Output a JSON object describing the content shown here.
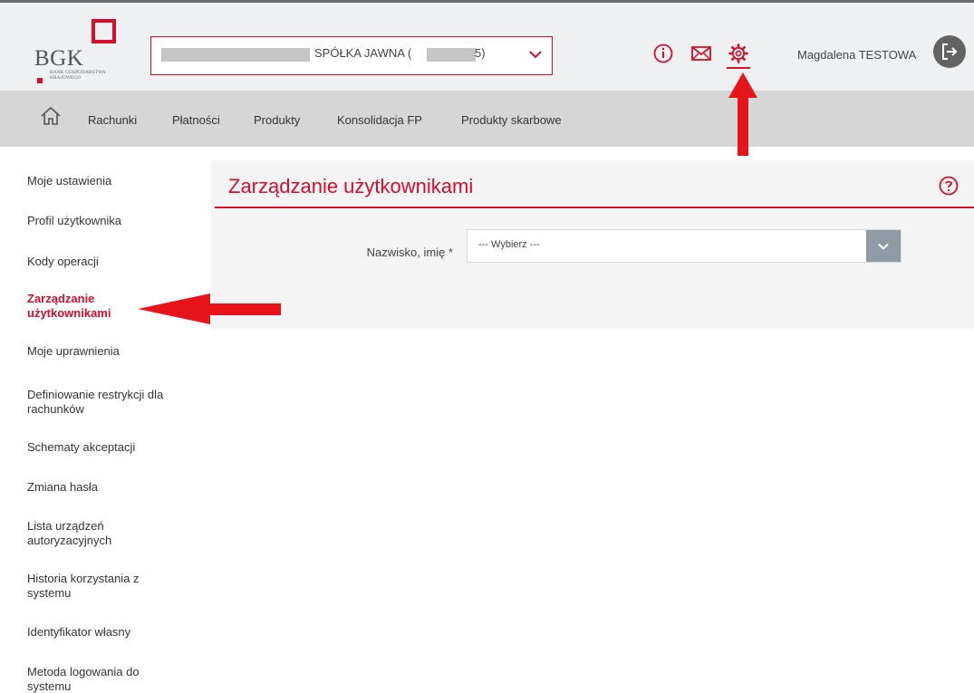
{
  "header": {
    "logo": {
      "brand": "BGK",
      "subtitle": "BANK GOSPODARSTWA KRAJOWEGO"
    },
    "company_select": {
      "value": "SPÓŁKA JAWNA (",
      "value_suffix": "5)"
    },
    "icons": [
      "info-icon",
      "mail-icon",
      "settings-icon"
    ],
    "user_name": "Magdalena TESTOWA"
  },
  "nav": {
    "items": [
      {
        "label": "Rachunki"
      },
      {
        "label": "Płatności"
      },
      {
        "label": "Produkty"
      },
      {
        "label": "Konsolidacja FP"
      },
      {
        "label": "Produkty skarbowe"
      }
    ]
  },
  "sidebar": {
    "items": [
      {
        "label": "Moje ustawienia"
      },
      {
        "label": "Profil użytkownika"
      },
      {
        "label": "Kody operacji"
      },
      {
        "label": "Zarządzanie użytkownikami",
        "active": true
      },
      {
        "label": "Moje uprawnienia"
      },
      {
        "label": "Definiowanie restrykcji dla rachunków"
      },
      {
        "label": "Schematy akceptacji"
      },
      {
        "label": "Zmiana hasła"
      },
      {
        "label": "Lista urządzeń autoryzacyjnych"
      },
      {
        "label": "Historia korzystania z systemu"
      },
      {
        "label": "Identyfikator własny"
      },
      {
        "label": "Metoda logowania do systemu"
      }
    ]
  },
  "main": {
    "title": "Zarządzanie użytkownikami",
    "form": {
      "user_label": "Nazwisko, imię *",
      "user_select_value": "--- Wybierz ---"
    }
  },
  "colors": {
    "accent": "#d50f2b",
    "header_bg": "#eef0f2",
    "nav_bg": "#d6d6d6",
    "panel_bg": "#f4f4f4",
    "arrow": "#e8141c"
  }
}
